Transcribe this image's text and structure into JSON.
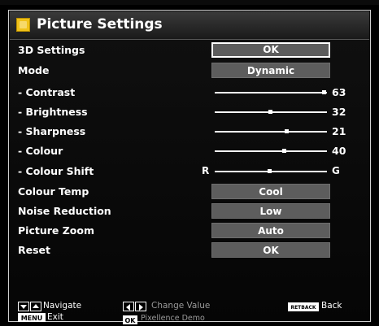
{
  "window": {
    "title": "Picture Settings"
  },
  "settings": [
    {
      "label": "3D Settings",
      "value": "OK",
      "selected": true
    },
    {
      "label": "Mode",
      "value": "Dynamic"
    }
  ],
  "sliders": [
    {
      "label": "- Contrast",
      "value": 63,
      "max": 63
    },
    {
      "label": "- Brightness",
      "value": 32,
      "max": 63
    },
    {
      "label": "- Sharpness",
      "value": 21,
      "max": 32
    },
    {
      "label": "- Colour",
      "value": 40,
      "max": 63
    }
  ],
  "colour_shift": {
    "label": "- Colour Shift",
    "left": "R",
    "right": "G",
    "position": 0.5
  },
  "settings2": [
    {
      "label": "Colour Temp",
      "value": "Cool"
    },
    {
      "label": "Noise Reduction",
      "value": "Low"
    },
    {
      "label": "Picture Zoom",
      "value": "Auto"
    },
    {
      "label": "Reset",
      "value": "OK"
    }
  ],
  "footer": {
    "navigate": "Navigate",
    "menu_key": "MENU",
    "exit": "Exit",
    "change_value": "Change Value",
    "ok_key": "OK",
    "pixellence": "Pixellence Demo",
    "return_key": "RETBACK",
    "back": "Back"
  },
  "colors": {
    "value_box": "#5d5d5d",
    "icon": "#f0c21a"
  }
}
